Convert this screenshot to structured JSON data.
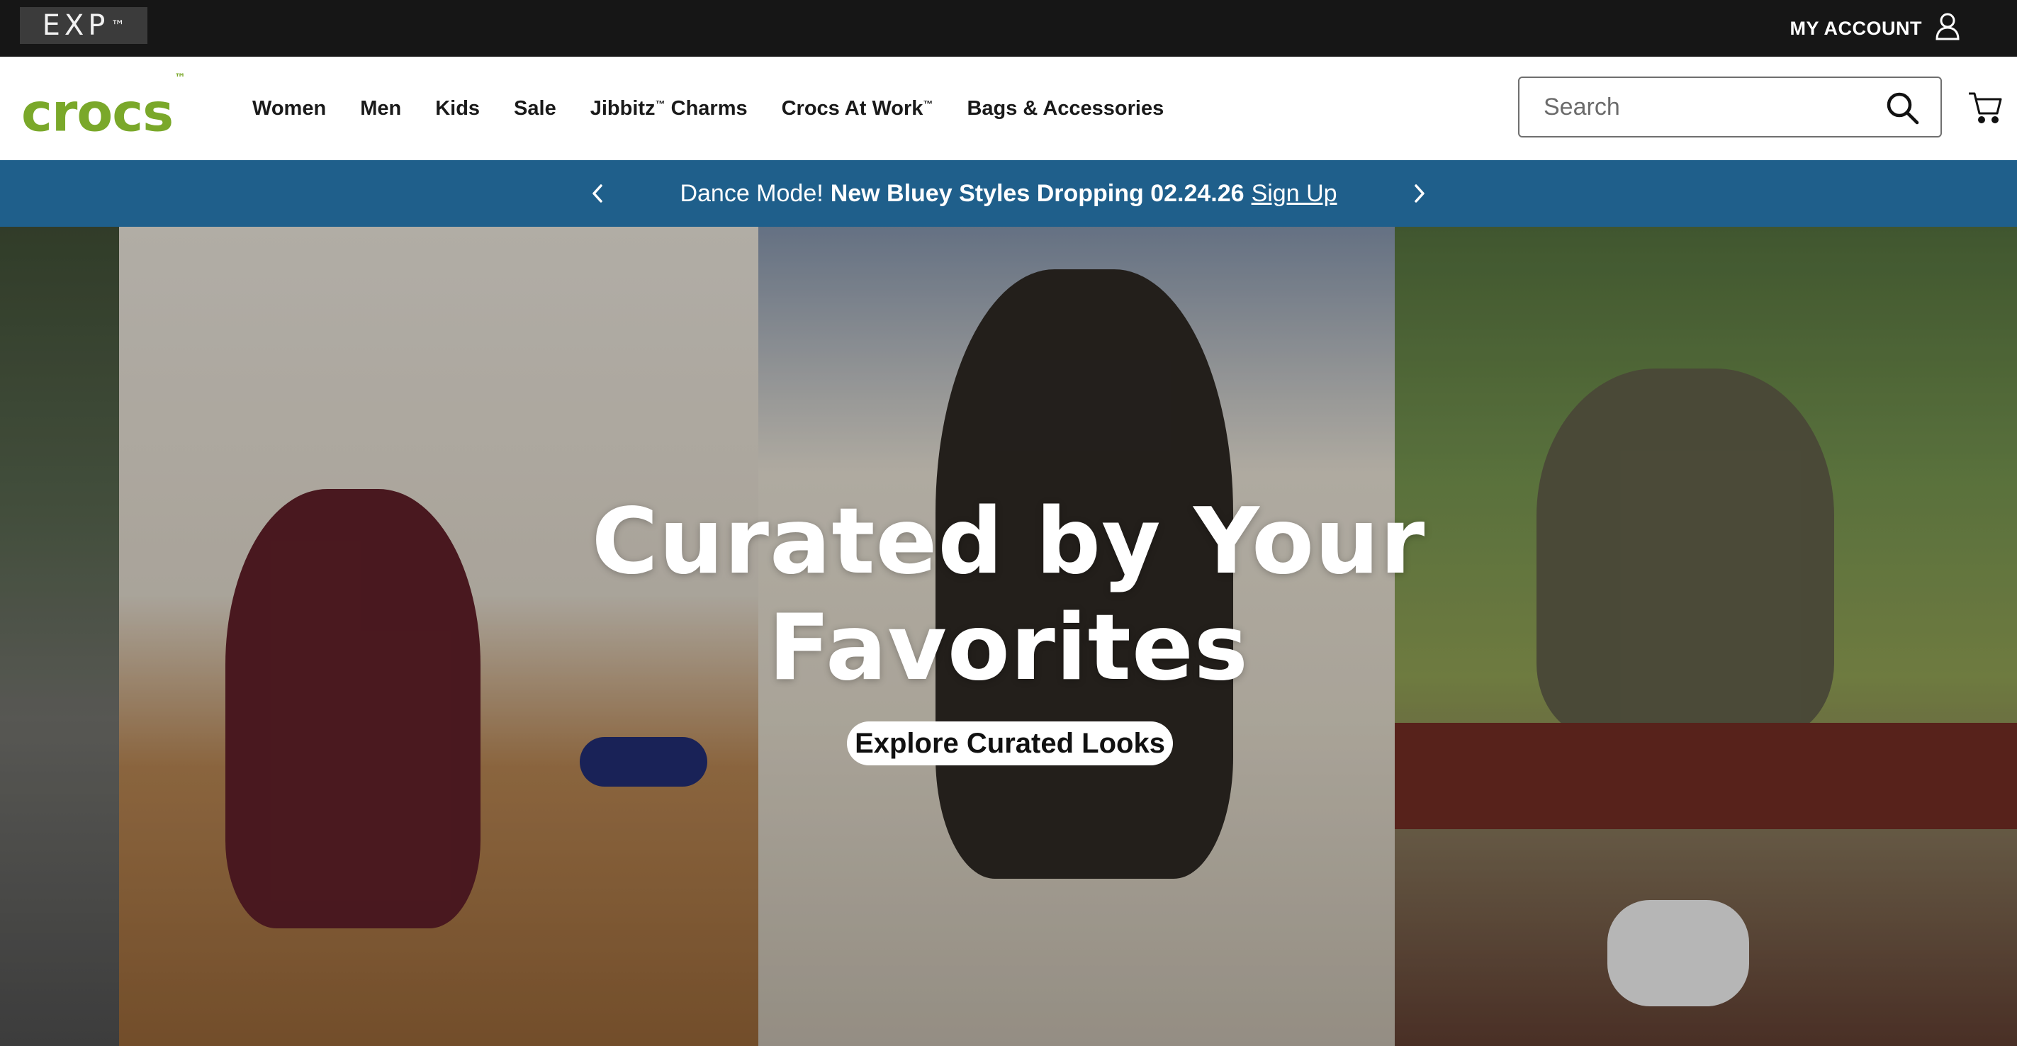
{
  "utility_bar": {
    "exp_label": "EXP",
    "exp_mark": "™",
    "account_label": "MY ACCOUNT",
    "account_icon": "user-icon"
  },
  "nav": {
    "logo_text": "crocs",
    "logo_mark": "™",
    "links": [
      {
        "label": "Women"
      },
      {
        "label": "Men"
      },
      {
        "label": "Kids"
      },
      {
        "label": "Sale"
      },
      {
        "label": "Jibbitz",
        "mark": "™",
        "suffix": " Charms"
      },
      {
        "label": "Crocs At Work",
        "mark": "™",
        "suffix": ""
      },
      {
        "label": "Bags & Accessories"
      }
    ],
    "search_placeholder": "Search",
    "search_icon": "search-icon",
    "cart_icon": "cart-icon"
  },
  "promo": {
    "lead": "Dance Mode!",
    "bold": "New Bluey Styles Dropping 02.24.26",
    "link": "Sign Up",
    "prev_icon": "chevron-left-icon",
    "next_icon": "chevron-right-icon"
  },
  "hero": {
    "title_line1": "Curated by Your",
    "title_line2": "Favorites",
    "cta_label": "Explore Curated Looks"
  },
  "colors": {
    "utility_bg": "#161616",
    "brand_green": "#7aa82a",
    "promo_bg": "#1f5f8b"
  }
}
